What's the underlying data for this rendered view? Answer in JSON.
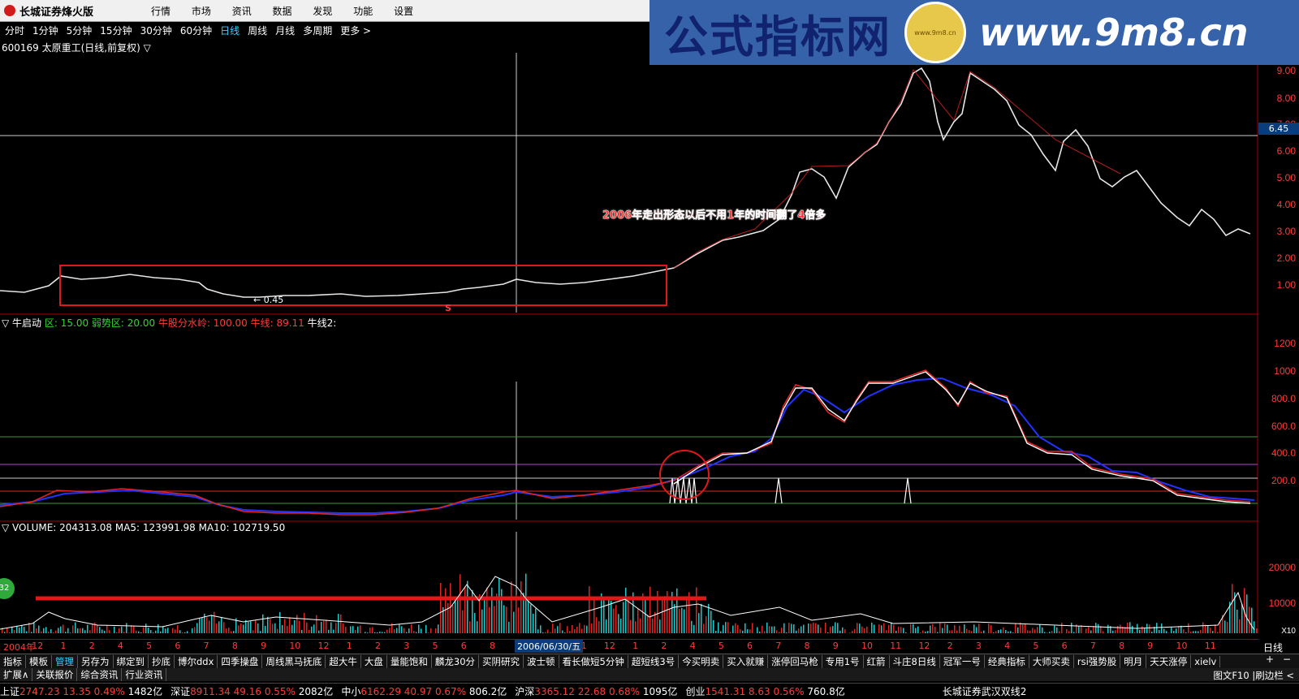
{
  "titlebar": {
    "app_title": "长城证券烽火版",
    "menu": [
      "行情",
      "市场",
      "资讯",
      "数据",
      "发现",
      "功能",
      "设置"
    ]
  },
  "banner": {
    "left_text": "公式指标网",
    "coin_text": "www.9m8.cn",
    "right_text": "www.9m8.cn"
  },
  "periods": [
    {
      "label": "分时",
      "active": false
    },
    {
      "label": "1分钟",
      "active": false
    },
    {
      "label": "5分钟",
      "active": false
    },
    {
      "label": "15分钟",
      "active": false
    },
    {
      "label": "30分钟",
      "active": false
    },
    {
      "label": "60分钟",
      "active": false
    },
    {
      "label": "日线",
      "active": true
    },
    {
      "label": "周线",
      "active": false
    },
    {
      "label": "月线",
      "active": false
    },
    {
      "label": "多周期",
      "active": false
    },
    {
      "label": "更多 >",
      "active": false
    }
  ],
  "stock": {
    "header": "600169 太原重工(日线,前复权) ▽"
  },
  "price_axis": [
    "9.00",
    "8.00",
    "7.00",
    "6.00",
    "5.00",
    "4.00",
    "3.00",
    "2.00",
    "1.00"
  ],
  "current_price_badge": "6.45",
  "annotation": "2006年走出形态以后不用1年的时间翻了4倍多",
  "min_price_label": "← 0.45",
  "signal_flag": "S",
  "indicator": {
    "name": "▽ 牛启动",
    "items": [
      {
        "text": "区: 15.00",
        "color": "#3ad03a"
      },
      {
        "text": "弱势区: 20.00",
        "color": "#3ad03a"
      },
      {
        "text": "牛股分水岭: 100.00",
        "color": "#ff3b3b"
      },
      {
        "text": "牛线: 89.11",
        "color": "#ff3b3b"
      },
      {
        "text": "牛线2:",
        "color": "#ffffff"
      }
    ],
    "axis": [
      "1200",
      "1000",
      "800.0",
      "600.0",
      "400.0",
      "200.0"
    ]
  },
  "volume": {
    "header": "▽ VOLUME: 204313.08  MA5: 123991.98  MA10: 102719.50",
    "axis": [
      "20000",
      "10000"
    ],
    "unit": "X10"
  },
  "time_axis": [
    "2004年",
    "12",
    "1",
    "2",
    "4",
    "5",
    "6",
    "7",
    "8",
    "9",
    "10",
    "12",
    "1",
    "2",
    "3",
    "5",
    "6",
    "8",
    "9",
    "10",
    "11",
    "12",
    "1",
    "2",
    "4",
    "5",
    "6",
    "7",
    "8",
    "9",
    "10",
    "11",
    "12",
    "2",
    "3",
    "4",
    "5",
    "6",
    "7",
    "8",
    "9",
    "10",
    "11"
  ],
  "date_flag": "2006/06/30/五",
  "day_label": "日线",
  "tabs": [
    "指标",
    "模板",
    "管理",
    "另存为",
    "绑定到",
    "抄底",
    "博尔ddx",
    "四季操盘",
    "周线黑马抚底",
    "超大牛",
    "大盘",
    "量能饱和",
    "麟龙30分",
    "买阴研究",
    "波士顿",
    "看长做短5分钟",
    "超短线3号",
    "今买明卖",
    "买入就赚",
    "涨停回马枪",
    "专用1号",
    "红箭",
    "斗庄8日线",
    "冠军一号",
    "经典指标",
    "大师买卖",
    "rsi强势股",
    "明月",
    "天天涨停",
    "xielv"
  ],
  "tabs_active": "管理",
  "subtabs": [
    "扩展∧",
    "关联报价",
    "综合资讯",
    "行业资讯"
  ],
  "f10": "图文F10  |刷边栏 <",
  "badge_circle": "32",
  "status": [
    {
      "name": "上证",
      "value": "2747.23",
      "chg": "13.35",
      "pct": "0.49%",
      "amt": "1482亿"
    },
    {
      "name": "深证",
      "value": "8911.34",
      "chg": "49.16",
      "pct": "0.55%",
      "amt": "2082亿"
    },
    {
      "name": "中小",
      "value": "6162.29",
      "chg": "40.97",
      "pct": "0.67%",
      "amt": "806.2亿"
    },
    {
      "name": "沪深",
      "value": "3365.12",
      "chg": "22.68",
      "pct": "0.68%",
      "amt": "1095亿"
    },
    {
      "name": "创业",
      "value": "1541.31",
      "chg": "8.63",
      "pct": "0.56%",
      "amt": "760.8亿"
    }
  ],
  "broker_text": "长城证券武汉双线2"
}
